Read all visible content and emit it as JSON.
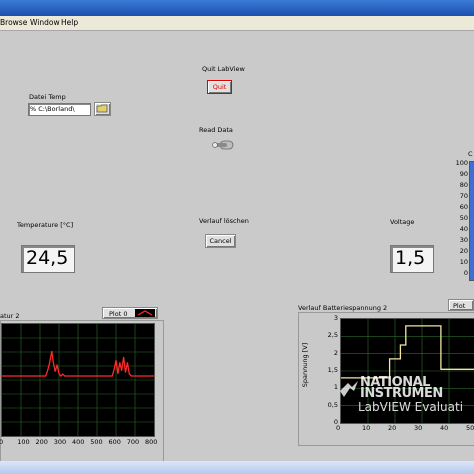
{
  "menu": [
    "Browse",
    "Window",
    "Help"
  ],
  "quit": {
    "label": "Quit LabView",
    "button": "Quit"
  },
  "file": {
    "label": "Datei Temp",
    "value": "C:\\Borland\\",
    "prefix": "%"
  },
  "read": {
    "label": "Read Data"
  },
  "temperature": {
    "label": "Temperature [°C]",
    "value": "24,5"
  },
  "reset": {
    "label": "Verlauf löschen",
    "button": "Cancel"
  },
  "voltage": {
    "label": "Voltage",
    "value": "1,5"
  },
  "gauge": {
    "top_label": "C",
    "ticks": [
      "100",
      "90",
      "80",
      "70",
      "60",
      "50",
      "40",
      "30",
      "20",
      "10",
      "0"
    ]
  },
  "chart1": {
    "title": "atur 2",
    "legend": "Plot 0",
    "xticks": [
      "0",
      "100",
      "200",
      "300",
      "400",
      "500",
      "600",
      "700",
      "800"
    ],
    "color": "#ff2a2a"
  },
  "chart2": {
    "title": "Verlauf Batteriespannung 2",
    "legend": "Plot",
    "ylabel": "Spannung [V]",
    "yticks": [
      "3",
      "2,5",
      "2",
      "1,5",
      "1",
      "0,5",
      "0"
    ],
    "xticks": [
      "0",
      "10",
      "20",
      "30",
      "40",
      "50"
    ],
    "color": "#f2e6a0"
  },
  "chart_data": [
    {
      "type": "line",
      "title": "atur 2",
      "x_range": [
        0,
        800
      ],
      "series": [
        {
          "name": "Plot 0",
          "x": [
            0,
            230,
            240,
            250,
            262,
            270,
            280,
            290,
            300,
            310,
            320,
            330,
            400,
            500,
            580,
            590,
            600,
            610,
            620,
            630,
            640,
            650,
            660,
            670,
            680,
            800
          ],
          "y": [
            0,
            0,
            0.12,
            0.28,
            0.55,
            0.3,
            0.1,
            0.25,
            0.05,
            0,
            0.04,
            0,
            0,
            0,
            0,
            0.15,
            0.35,
            0.05,
            0.3,
            0.12,
            0.42,
            0.08,
            0.3,
            0.05,
            0,
            0
          ]
        }
      ]
    },
    {
      "type": "line",
      "title": "Verlauf Batteriespannung 2",
      "ylabel": "Spannung [V]",
      "y_range": [
        0,
        3
      ],
      "x_range": [
        0,
        50
      ],
      "series": [
        {
          "name": "Plot",
          "x": [
            0,
            18,
            18,
            22,
            22,
            24,
            24,
            37,
            37,
            50
          ],
          "y": [
            1.3,
            1.3,
            1.85,
            1.85,
            2.25,
            2.25,
            2.8,
            2.8,
            1.55,
            1.55
          ]
        }
      ]
    }
  ]
}
